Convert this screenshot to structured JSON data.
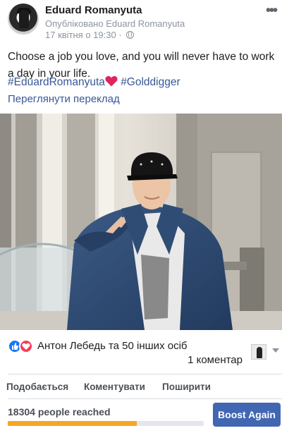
{
  "post": {
    "author_name": "Eduard Romanyuta",
    "published_by": "Опубліковано Eduard Romanyuta",
    "timestamp": "17 квітня о 19:30",
    "separator": "·",
    "more_label": "•••",
    "text": "Choose a job you love, and you will never have to work a day in your life.",
    "hashtag_1": "#EduardRomanyuta",
    "hashtag_2": "#Golddigger",
    "translate_link": "Переглянути переклад"
  },
  "reactions": {
    "summary": "Антон Лебедь та 50 інших осіб",
    "comments": "1 коментар",
    "icons": [
      "like-icon",
      "love-icon"
    ],
    "like_color": "#1877f2",
    "love_color": "#f33e58"
  },
  "actions": {
    "like": "Подобається",
    "comment": "Коментувати",
    "share": "Поширити"
  },
  "boost": {
    "reached_text": "18304 people reached",
    "progress_fraction": 0.66,
    "button_label": "Boost Again",
    "button_color": "#4267b2",
    "progress_color": "#f5a623"
  }
}
